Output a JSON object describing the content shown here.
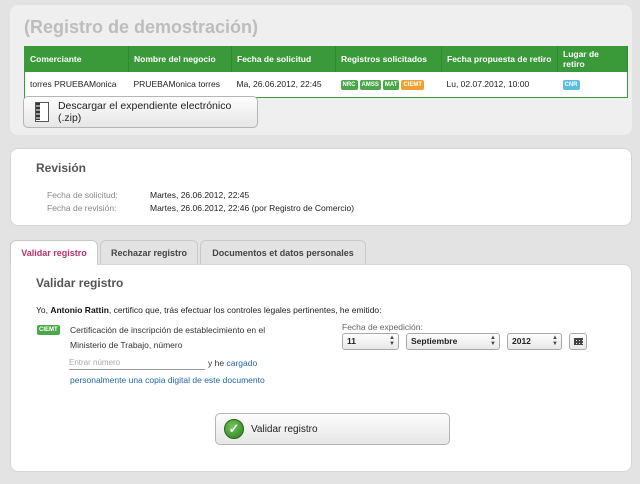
{
  "header": {
    "title": "(Registro de demostración)"
  },
  "table": {
    "columns": [
      "Comerciante",
      "Nombre del negocio",
      "Fecha de solicitud",
      "Registros solicitados",
      "Fecha propuesta de retiro",
      "Lugar de retiro"
    ],
    "row": {
      "comerciante": "torres PRUEBAMonica",
      "negocio": "PRUEBAMonica torres",
      "fecha_solicitud": "Ma, 26.06.2012, 22:45",
      "registros": [
        "NRC",
        "AMSS",
        "MAT",
        "CIEMT"
      ],
      "fecha_retiro": "Lu, 02.07.2012, 10:00",
      "lugar": "CNR"
    }
  },
  "download": {
    "label": "Descargar el expendiente electrónico (.zip)"
  },
  "revision": {
    "title": "Revisión",
    "rows": [
      {
        "key": "Fecha de solicitud:",
        "value": "Martes, 26.06.2012, 22:45"
      },
      {
        "key": "Fecha de revisión:",
        "value": "Martes, 26.06.2012, 22:46 (por Registro de Comercio)"
      }
    ]
  },
  "tabs": [
    "Validar registro",
    "Rechazar registro",
    "Documentos et datos personales"
  ],
  "validar": {
    "title": "Validar registro",
    "cert_prefix": "Yo, ",
    "cert_name": "Antonio Rattin",
    "cert_suffix": ", certifico que, trás efectuar los controles legales pertinentes, he emitido:",
    "badge": "CIEMT",
    "cert_text": "Certificación de inscripción de establecimiento en el Ministerio de Trabajo, número",
    "input_placeholder": "Entrar número",
    "yhe": "y he",
    "cargado": "cargado",
    "personal": "personalmente una copia digital de este documento",
    "fecha_label": "Fecha de expedición:",
    "day": "11",
    "month": "Septiembre",
    "year": "2012",
    "button": "Validar registro"
  }
}
